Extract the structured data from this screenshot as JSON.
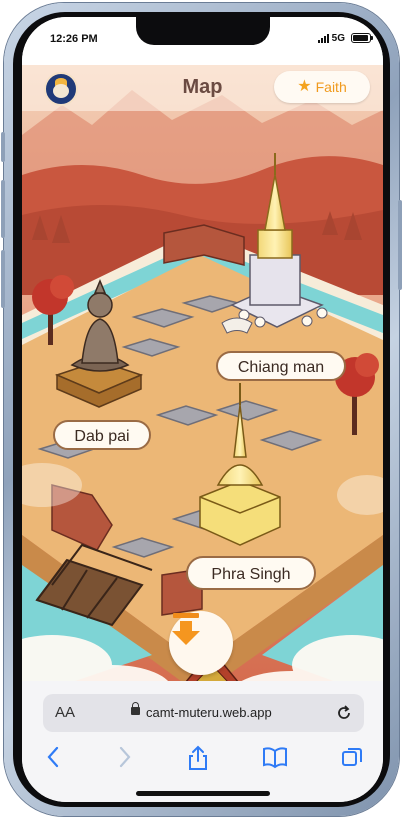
{
  "status_bar": {
    "time": "12:26 PM",
    "network": "5G"
  },
  "header": {
    "title": "Map",
    "faith_label": "Faith"
  },
  "locations": [
    {
      "name": "Chiang man"
    },
    {
      "name": "Dab pai"
    },
    {
      "name": "Phra Singh"
    }
  ],
  "browser": {
    "text_size_label": "AA",
    "url": "camt-muteru.web.app"
  },
  "icons": {
    "avatar": "avatar-icon",
    "faith": "star-icon",
    "scroll_down": "arrow-down-icon",
    "lock": "lock-icon",
    "reload": "reload-icon",
    "back": "back-arrow-icon",
    "forward": "forward-arrow-icon",
    "share": "share-icon",
    "bookmarks": "book-icon",
    "tabs": "tabs-icon"
  },
  "colors": {
    "accent": "#f09a1e",
    "title": "#6b4b42",
    "nav_blue": "#2f7bf6"
  }
}
